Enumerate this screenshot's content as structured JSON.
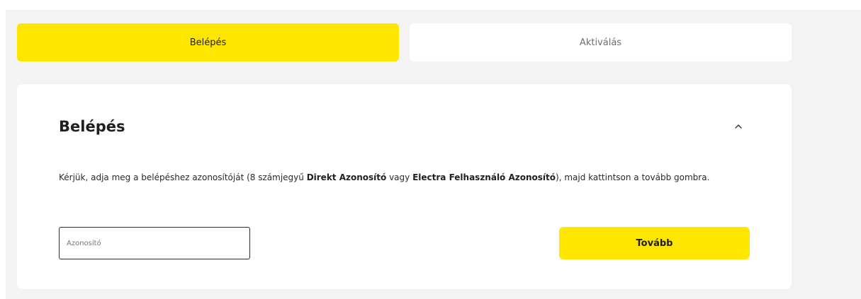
{
  "tabs": {
    "login_label": "Belépés",
    "activation_label": "Aktiválás"
  },
  "card": {
    "title": "Belépés",
    "expand_icon": "chevron-up-icon",
    "description": {
      "part1": "Kérjük, adja meg a belépéshez  azonosítóját (8 számjegyű ",
      "bold1": "Direkt Azonosító",
      "part2": " vagy ",
      "bold2": "Electra Felhasználó Azonosító",
      "part3": "), majd kattintson a tovább gombra."
    },
    "id_input": {
      "placeholder": "Azonosító",
      "value": ""
    },
    "next_label": "Tovább"
  },
  "colors": {
    "accent": "#ffe600",
    "background": "#f3f3f3",
    "card": "#ffffff",
    "text": "#1f1f1f"
  }
}
